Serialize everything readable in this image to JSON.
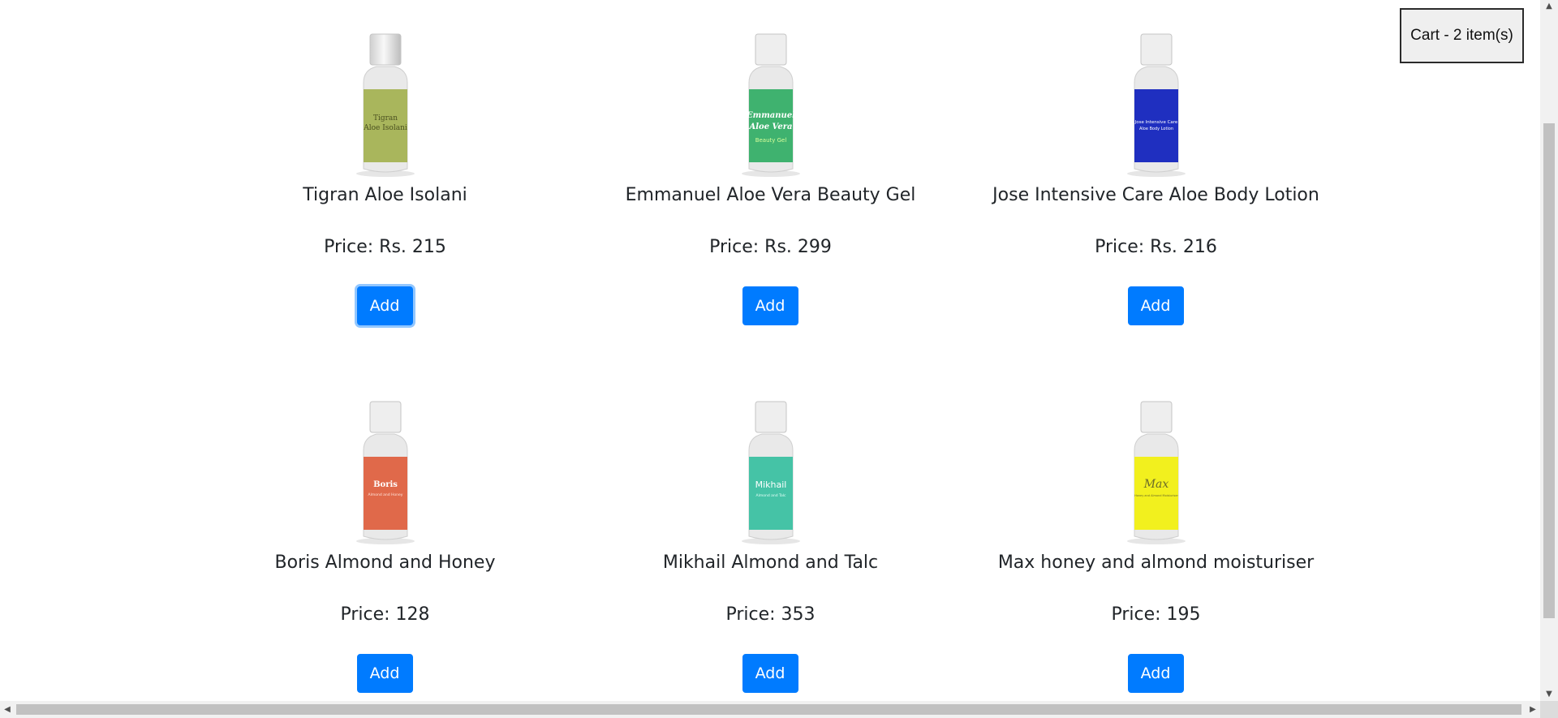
{
  "cart": {
    "label": "Cart - 2 item(s)"
  },
  "products": [
    {
      "name": "Tigran Aloe Isolani",
      "price": "Price: Rs. 215",
      "add_label": "Add",
      "image": {
        "label_line1": "Tigran",
        "label_line2": "Aloe Isolani",
        "label_line3": "",
        "color": "#a9b65c",
        "text_color": "#4a5020"
      }
    },
    {
      "name": "Emmanuel Aloe Vera Beauty Gel",
      "price": "Price: Rs. 299",
      "add_label": "Add",
      "image": {
        "label_line1": "Emmanuel",
        "label_line2": "Aloe Vera",
        "label_line3": "Beauty Gel",
        "color": "#3fb26f",
        "text_color": "#ffffff"
      }
    },
    {
      "name": "Jose Intensive Care Aloe Body Lotion",
      "price": "Price: Rs. 216",
      "add_label": "Add",
      "image": {
        "label_line1": "Jose Intensive Care",
        "label_line2": "Aloe Body Lotion",
        "label_line3": "",
        "color": "#1f2fc0",
        "text_color": "#ffffff"
      }
    },
    {
      "name": "Boris Almond and Honey",
      "price": "Price: 128",
      "add_label": "Add",
      "image": {
        "label_line1": "Boris",
        "label_line2": "Almond and Honey",
        "label_line3": "",
        "color": "#e0694a",
        "text_color": "#ffffff"
      }
    },
    {
      "name": "Mikhail Almond and Talc",
      "price": "Price: 353",
      "add_label": "Add",
      "image": {
        "label_line1": "Mikhail",
        "label_line2": "Almond and Talc",
        "label_line3": "",
        "color": "#45c3a6",
        "text_color": "#ffffff"
      }
    },
    {
      "name": "Max honey and almond moisturiser",
      "price": "Price: 195",
      "add_label": "Add",
      "image": {
        "label_line1": "Max",
        "label_line2": "Honey and Almond Moisturiser",
        "label_line3": "",
        "color": "#f2f01e",
        "text_color": "#6a6a2a"
      }
    }
  ],
  "colors": {
    "button": "#007bff",
    "button_text": "#ffffff"
  }
}
